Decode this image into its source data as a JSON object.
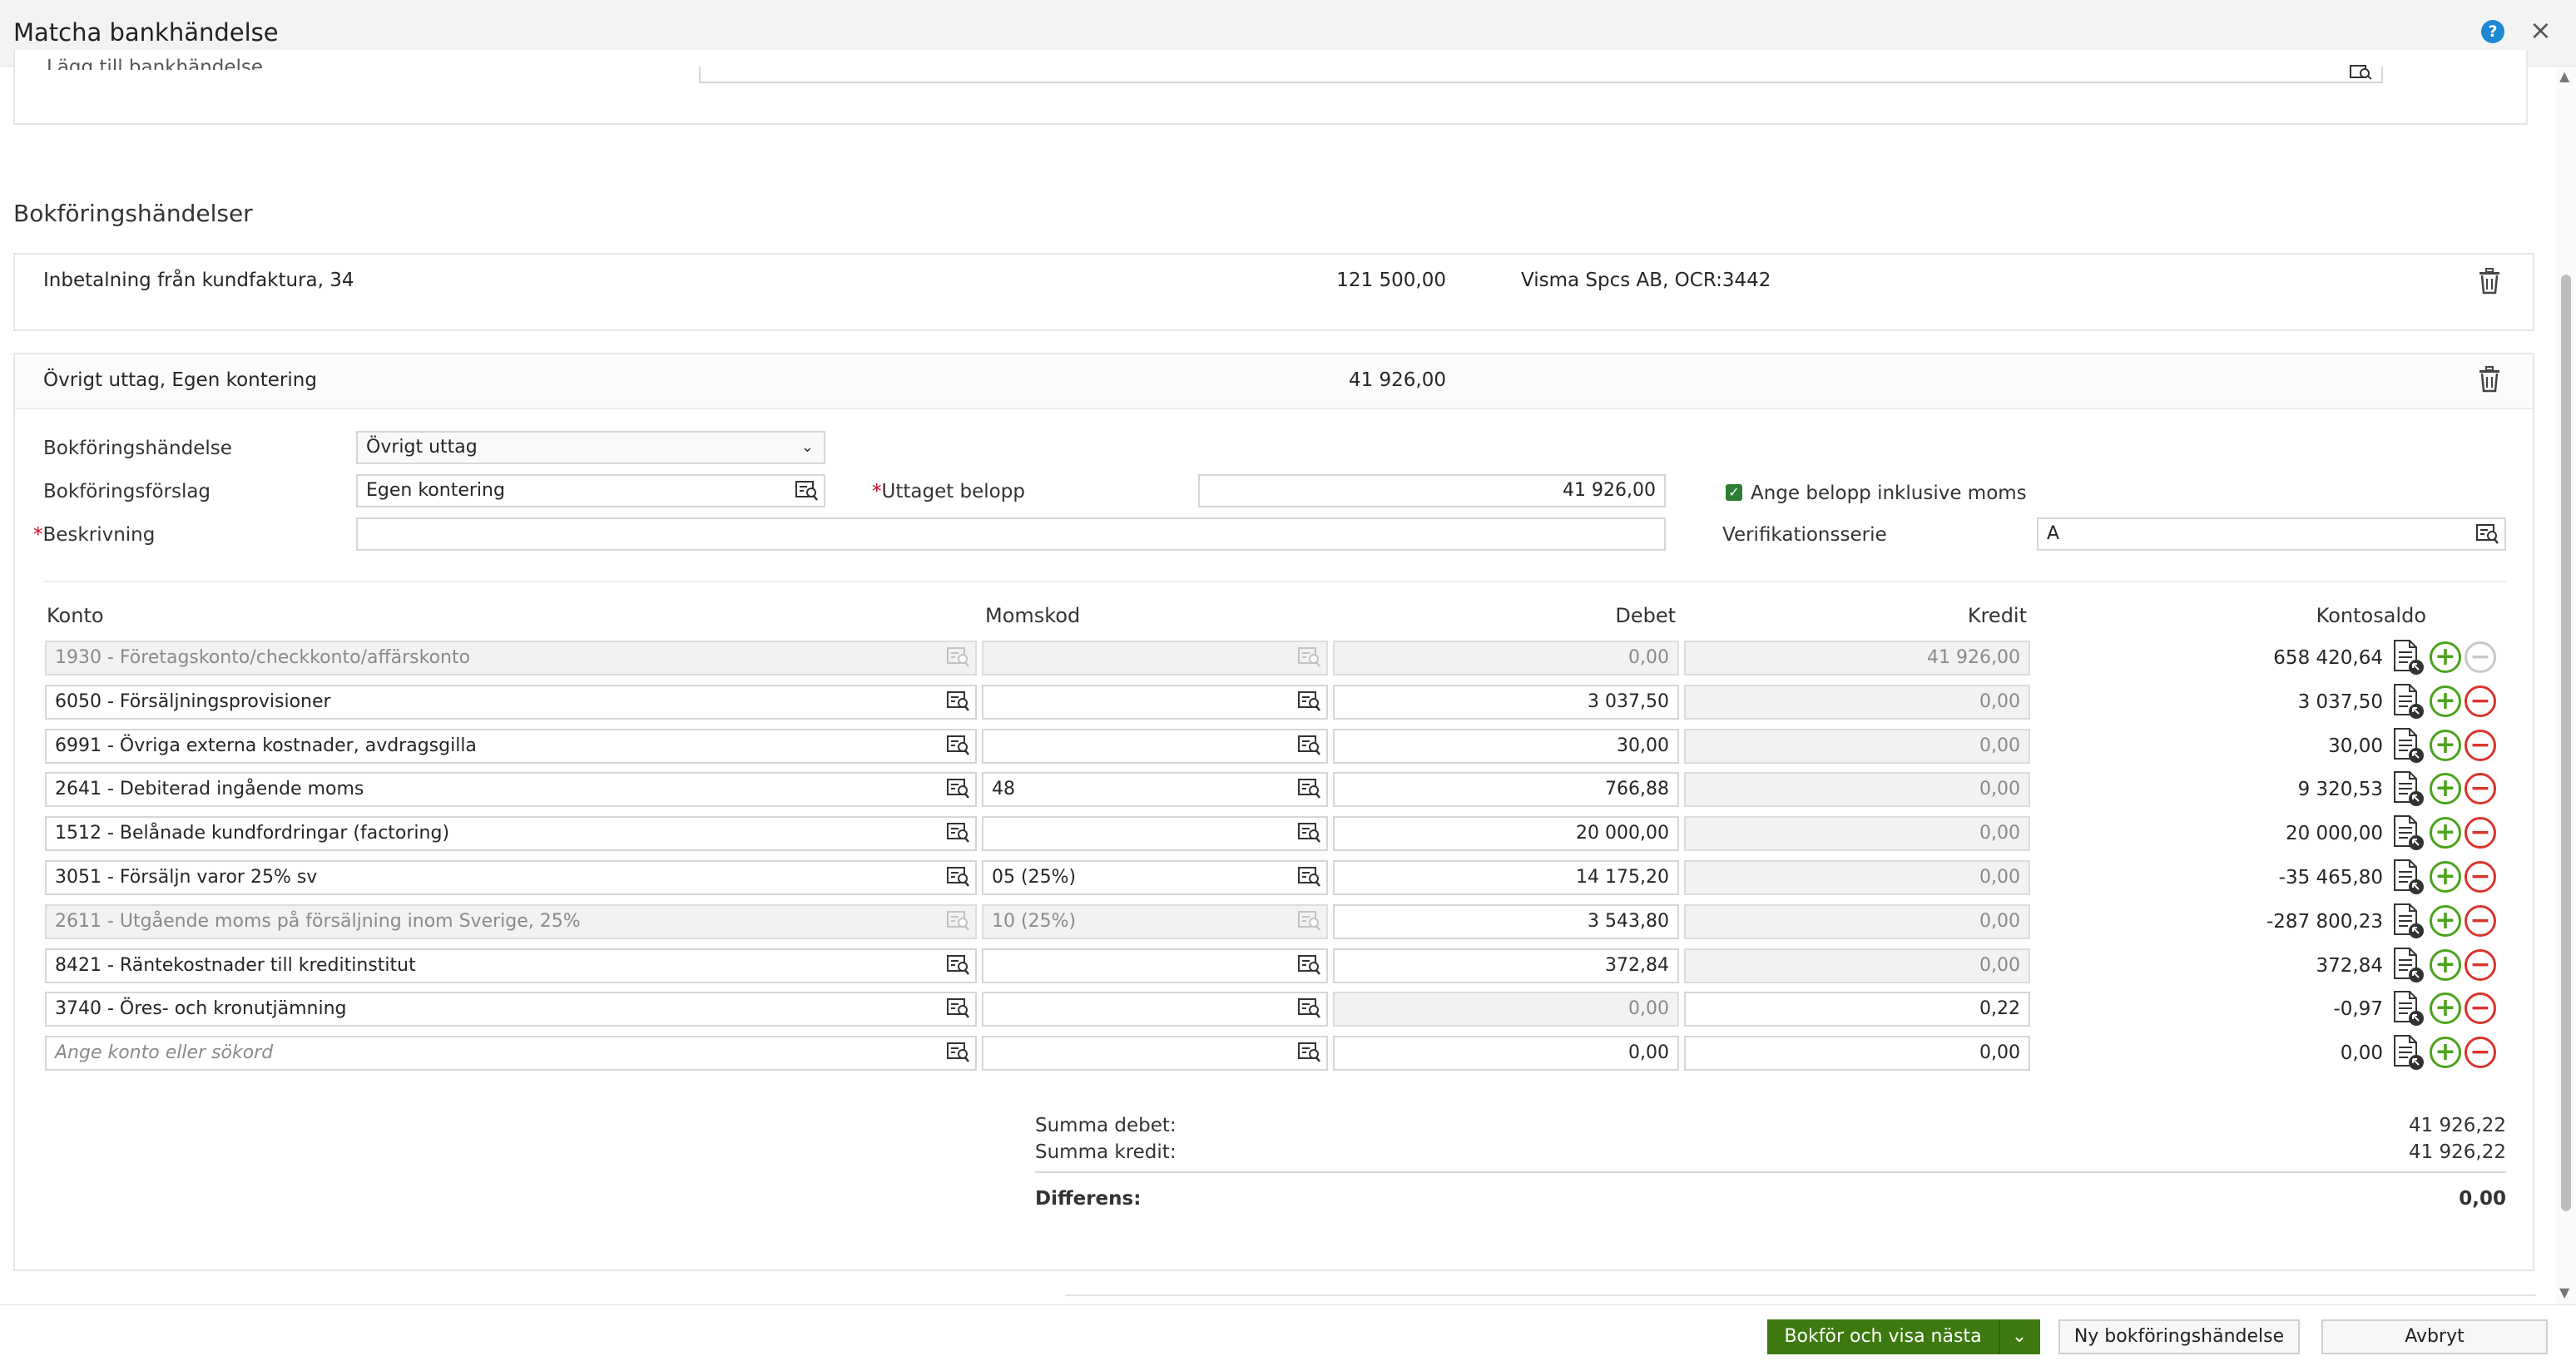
{
  "window": {
    "title": "Matcha bankhändelse",
    "help_label": "?",
    "close_label": "×"
  },
  "top_section": {
    "add_label": "Lägg till bankhändelse"
  },
  "section_title": "Bokföringshändelser",
  "event1": {
    "description": "Inbetalning från kundfaktura, 34",
    "amount": "121 500,00",
    "reference": "Visma Spcs AB, OCR:3442"
  },
  "event2": {
    "description": "Övrigt uttag, Egen kontering",
    "amount": "41 926,00"
  },
  "form": {
    "event_label": "Bokföringshändelse",
    "event_value": "Övrigt uttag",
    "suggestion_label": "Bokföringsförslag",
    "suggestion_value": "Egen kontering",
    "amount_label": "Uttaget belopp",
    "amount_value": "41 926,00",
    "vat_checkbox_label": "Ange belopp inklusive moms",
    "vat_checked": true,
    "description_label": "Beskrivning",
    "description_value": "",
    "series_label": "Verifikationsserie",
    "series_value": "A",
    "required_mark": "*"
  },
  "table": {
    "headers": {
      "account": "Konto",
      "vat": "Momskod",
      "debit": "Debet",
      "credit": "Kredit",
      "balance": "Kontosaldo"
    },
    "rows": [
      {
        "account": "1930 - Företagskonto/checkkonto/affärskonto",
        "vat": "",
        "debit": "0,00",
        "credit": "41 926,00",
        "balance": "658 420,64"
      },
      {
        "account": "6050 - Försäljningsprovisioner",
        "vat": "",
        "debit": "3 037,50",
        "credit": "0,00",
        "balance": "3 037,50"
      },
      {
        "account": "6991 - Övriga externa kostnader, avdragsgilla",
        "vat": "",
        "debit": "30,00",
        "credit": "0,00",
        "balance": "30,00"
      },
      {
        "account": "2641 - Debiterad ingående moms",
        "vat": "48",
        "debit": "766,88",
        "credit": "0,00",
        "balance": "9 320,53"
      },
      {
        "account": "1512 - Belånade kundfordringar (factoring)",
        "vat": "",
        "debit": "20 000,00",
        "credit": "0,00",
        "balance": "20 000,00"
      },
      {
        "account": "3051 - Försäljn varor 25% sv",
        "vat": "05 (25%)",
        "debit": "14 175,20",
        "credit": "0,00",
        "balance": "-35 465,80"
      },
      {
        "account": "2611 - Utgående moms på försäljning inom Sverige, 25%",
        "vat": "10 (25%)",
        "debit": "3 543,80",
        "credit": "0,00",
        "balance": "-287 800,23"
      },
      {
        "account": "8421 - Räntekostnader till kreditinstitut",
        "vat": "",
        "debit": "372,84",
        "credit": "0,00",
        "balance": "372,84"
      },
      {
        "account": "3740 - Öres- och kronutjämning",
        "vat": "",
        "debit": "0,00",
        "credit": "0,22",
        "balance": "-0,97"
      },
      {
        "account": "Ange konto eller sökord",
        "vat": "",
        "debit": "0,00",
        "credit": "0,00",
        "balance": "0,00"
      }
    ]
  },
  "totals": {
    "debit_label": "Summa debet:",
    "debit_value": "41 926,22",
    "credit_label": "Summa kredit:",
    "credit_value": "41 926,22",
    "diff_label": "Differens:",
    "diff_value": "0,00"
  },
  "footer": {
    "primary_label": "Bokför och visa nästa",
    "new_label": "Ny bokföringshändelse",
    "cancel_label": "Avbryt"
  },
  "colors": {
    "accent_green": "#3c7a0f",
    "plus_green": "#4aa31a",
    "minus_red": "#d9342b",
    "help_blue": "#1b88d1"
  }
}
